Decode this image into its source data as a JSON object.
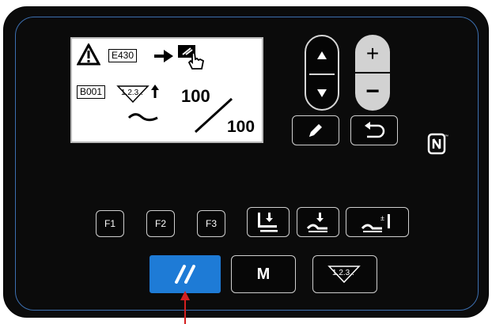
{
  "display": {
    "error_code": "E430",
    "program_code": "B001",
    "step_label": "1.2.3..",
    "count_current": "100",
    "count_total": "100"
  },
  "keys": {
    "f1": "F1",
    "f2": "F2",
    "f3": "F3",
    "menu": "M",
    "plus": "+",
    "minus": "−"
  },
  "icons": {
    "warning": "warning-triangle-icon",
    "arrow": "right-arrow-icon",
    "hand": "hand-press-icon",
    "pencil": "pencil-icon",
    "return": "return-icon",
    "nfc": "nfc-icon",
    "reset": "double-slash-icon"
  },
  "colors": {
    "panel": "#0b0b0b",
    "accent_blue": "#1e7bd6",
    "inner_border": "#3c6fb0",
    "pointer_red": "#d41f1f"
  }
}
